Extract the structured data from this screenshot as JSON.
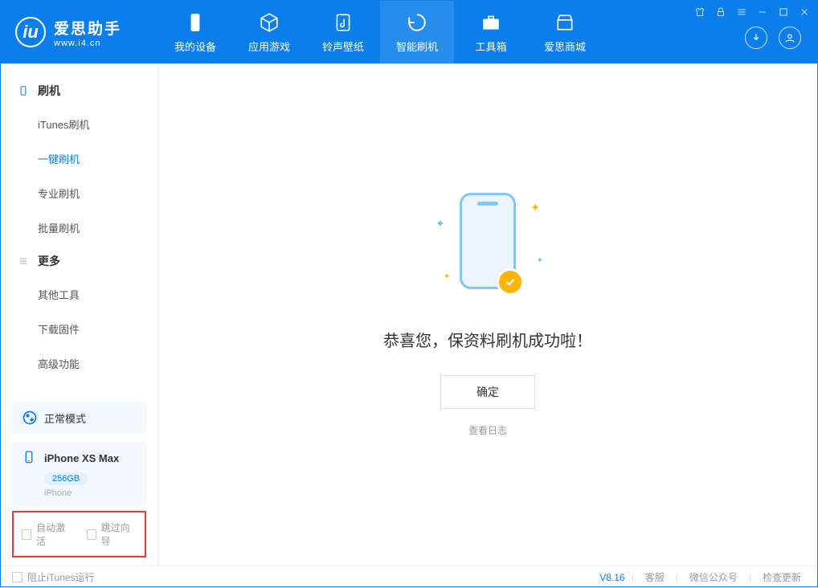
{
  "app": {
    "name": "爱思助手",
    "url": "www.i4.cn"
  },
  "nav": {
    "items": [
      {
        "label": "我的设备"
      },
      {
        "label": "应用游戏"
      },
      {
        "label": "铃声壁纸"
      },
      {
        "label": "智能刷机"
      },
      {
        "label": "工具箱"
      },
      {
        "label": "爱思商城"
      }
    ]
  },
  "sidebar": {
    "group1": {
      "title": "刷机"
    },
    "items1": [
      {
        "label": "iTunes刷机"
      },
      {
        "label": "一键刷机"
      },
      {
        "label": "专业刷机"
      },
      {
        "label": "批量刷机"
      }
    ],
    "group2": {
      "title": "更多"
    },
    "items2": [
      {
        "label": "其他工具"
      },
      {
        "label": "下载固件"
      },
      {
        "label": "高级功能"
      }
    ]
  },
  "mode": {
    "label": "正常模式"
  },
  "device": {
    "name": "iPhone XS Max",
    "storage": "256GB",
    "type": "iPhone"
  },
  "checks": {
    "auto_activate": "自动激活",
    "skip_guide": "跳过向导"
  },
  "main": {
    "success": "恭喜您，保资料刷机成功啦！",
    "ok": "确定",
    "log": "查看日志"
  },
  "footer": {
    "block_itunes": "阻止iTunes运行",
    "version": "V8.16",
    "service": "客服",
    "wechat": "微信公众号",
    "update": "检查更新"
  }
}
